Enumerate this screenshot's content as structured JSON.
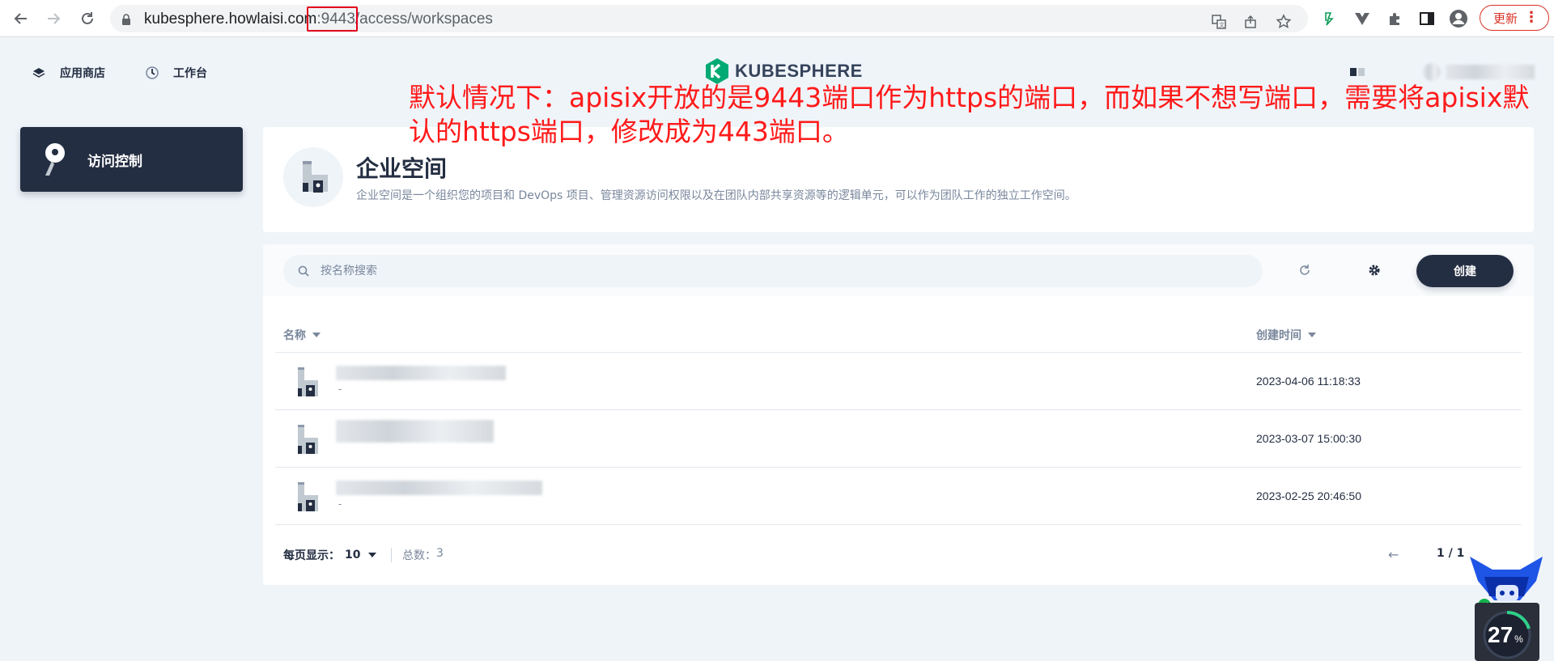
{
  "browser": {
    "url_host": "kubesphere.howlaisi.com",
    "url_port": ":9443",
    "url_path": "/access/workspaces",
    "update_label": "更新",
    "update_menu": "⋮"
  },
  "header": {
    "nav_items": [
      {
        "label": "应用商店",
        "icon": "layers-icon"
      },
      {
        "label": "工作台",
        "icon": "dashboard-icon"
      }
    ],
    "logo_text": "KUBESPHERE"
  },
  "annotation": {
    "text": "默认情况下：apisix开放的是9443端口作为https的端口，而如果不想写端口，需要将apisix默认的https端口，修改成为443端口。",
    "color": "#ff1a1a"
  },
  "sidebar": {
    "items": [
      {
        "label": "访问控制",
        "icon": "key-icon",
        "active": true
      }
    ]
  },
  "banner": {
    "title": "企业空间",
    "description": "企业空间是一个组织您的项目和 DevOps 项目、管理资源访问权限以及在团队内部共享资源等的逻辑单元，可以作为团队工作的独立工作空间。"
  },
  "toolbar": {
    "search_placeholder": "按名称搜索",
    "create_label": "创建"
  },
  "table": {
    "columns": [
      "名称",
      "创建时间"
    ],
    "rows": [
      {
        "description": "-",
        "created": "2023-04-06 11:18:33"
      },
      {
        "description": "",
        "created": "2023-03-07 15:00:30"
      },
      {
        "description": "-",
        "created": "2023-02-25 20:46:50"
      }
    ]
  },
  "pagination": {
    "per_page_label": "每页显示：",
    "per_page_value": "10",
    "total_label": "总数：",
    "total_value": "3",
    "prev_arrow": "←",
    "page_indicator": "1 / 1"
  },
  "widget": {
    "percent": "27",
    "percent_unit": "%"
  },
  "colors": {
    "primary_dark": "#242e42",
    "background": "#eff4f9",
    "muted_text": "#79879c",
    "logo_green": "#00aa72",
    "annotation_red": "#ff1a1a"
  }
}
